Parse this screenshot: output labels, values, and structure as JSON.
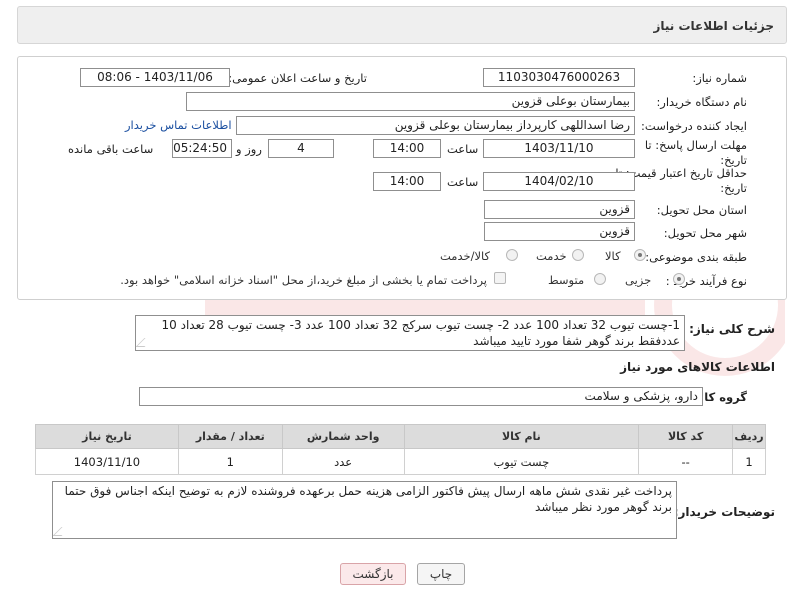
{
  "header": {
    "title": "جزئیات اطلاعات نیاز"
  },
  "form": {
    "need_number_label": "شماره نیاز:",
    "need_number": "1103030476000263",
    "announce_label": "تاریخ و ساعت اعلان عمومی:",
    "announce_value": "1403/11/06 - 08:06",
    "buyer_org_label": "نام دستگاه خریدار:",
    "buyer_org": "بیمارستان بوعلی قزوین",
    "creator_label": "ایجاد کننده درخواست:",
    "creator": "رضا اسداللهی کارپرداز بیمارستان بوعلی قزوین",
    "contact_link": "اطلاعات تماس خریدار",
    "deadline_label_1": "مهلت ارسال پاسخ: تا",
    "deadline_label_2": "تاریخ:",
    "deadline_date": "1403/11/10",
    "time_label": "ساعت",
    "deadline_time": "14:00",
    "days_value": "4",
    "days_label": "روز و",
    "remaining_time": "05:24:50",
    "remaining_label": "ساعت باقی مانده",
    "validity_label_1": "حداقل تاریخ اعتبار قیمت: تا",
    "validity_label_2": "تاریخ:",
    "validity_date": "1404/02/10",
    "validity_time_label": "ساعت",
    "validity_time": "14:00",
    "province_label": "استان محل تحویل:",
    "province": "قزوین",
    "city_label": "شهر محل تحویل:",
    "city": "قزوین",
    "category_label": "طبقه بندی موضوعی:",
    "category_options": [
      "کالا",
      "خدمت",
      "کالا/خدمت"
    ],
    "process_label": "نوع فرآیند خرید :",
    "process_options": [
      "جزیی",
      "متوسط"
    ],
    "payment_note": "پرداخت تمام یا بخشی از مبلغ خرید،از محل \"اسناد خزانه اسلامی\" خواهد بود."
  },
  "description": {
    "label": "شرح کلی نیاز:",
    "text": "1-چست تیوب 32 تعداد 100 عدد 2- چست تیوب سرکج 32 تعداد 100 عدد 3- چست تیوب 28 تعداد 10 عددفقط برند گوهر شفا مورد تایید میباشد"
  },
  "goods": {
    "section_title": "اطلاعات کالاهای مورد نیاز",
    "group_label": "گروه کالا:",
    "group_value": "دارو، پزشکی و سلامت",
    "columns": [
      "ردیف",
      "کد کالا",
      "نام کالا",
      "واحد شمارش",
      "تعداد / مقدار",
      "تاریخ نیاز"
    ],
    "rows": [
      [
        "1",
        "--",
        "چست تیوب",
        "عدد",
        "1",
        "1403/11/10"
      ]
    ]
  },
  "buyer_notes": {
    "label": "توضیحات خریدار:",
    "text": "پرداخت غیر نقدی شش ماهه ارسال پیش فاکتور الزامی هزینه حمل برعهده فروشنده لازم به توضیح اینکه اجناس فوق حتما برند گوهر مورد نظر میباشد"
  },
  "buttons": {
    "print": "چاپ",
    "back": "بازگشت"
  },
  "colors": {
    "link": "#1b4fa0",
    "back_button": "#fbe9ea",
    "header_bg": "#efefef"
  }
}
